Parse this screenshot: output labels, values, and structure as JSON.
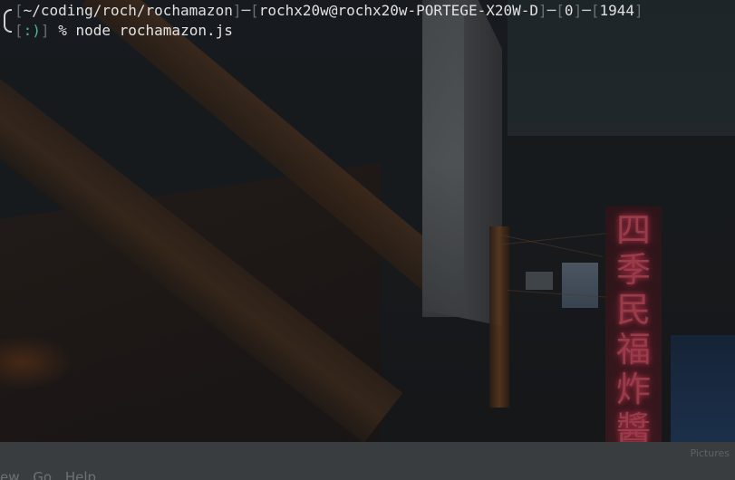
{
  "terminal": {
    "prompt": {
      "path": "~/coding/roch/rochamazon",
      "user_host": "rochx20w@rochx20w-PORTEGE-X20W-D",
      "exit_code": "0",
      "history_number": "1944",
      "status_face": ":)",
      "symbol": "%"
    },
    "command": "node rochamazon.js"
  },
  "bottom_panel": {
    "tab_label": "Pictures",
    "menu_items": [
      "ew",
      "Go",
      "Help"
    ]
  },
  "colors": {
    "background": "#1c1e20",
    "bracket": "#6a6e70",
    "status_face": "#4fb39a",
    "sign_neon": "#e0566a"
  },
  "wallpaper": {
    "sign_glyphs": [
      "四",
      "季",
      "民",
      "福",
      "炸",
      "醬"
    ]
  }
}
